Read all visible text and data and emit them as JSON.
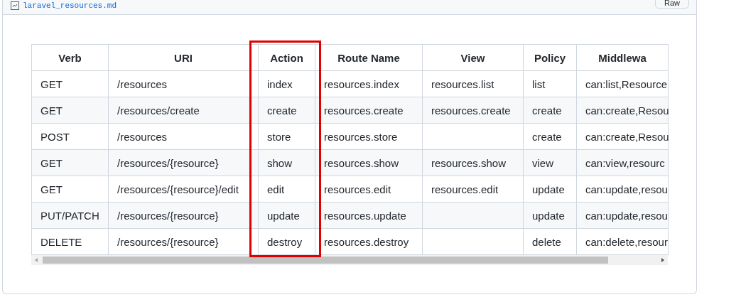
{
  "file_header": {
    "file_name": "laravel_resources.md",
    "raw_button": "Raw"
  },
  "table": {
    "columns": [
      {
        "label": "Verb",
        "highlighted": false
      },
      {
        "label": "URI",
        "highlighted": false
      },
      {
        "label": "Action",
        "highlighted": true
      },
      {
        "label": "Route Name",
        "highlighted": false
      },
      {
        "label": "View",
        "highlighted": false
      },
      {
        "label": "Policy",
        "highlighted": false
      },
      {
        "label": "Middlewa",
        "highlighted": false
      }
    ],
    "rows": [
      [
        "GET",
        "/resources",
        "index",
        "resources.index",
        "resources.list",
        "list",
        "can:list,Resource"
      ],
      [
        "GET",
        "/resources/create",
        "create",
        "resources.create",
        "resources.create",
        "create",
        "can:create,Resou"
      ],
      [
        "POST",
        "/resources",
        "store",
        "resources.store",
        "",
        "create",
        "can:create,Resou"
      ],
      [
        "GET",
        "/resources/{resource}",
        "show",
        "resources.show",
        "resources.show",
        "view",
        "can:view,resourc"
      ],
      [
        "GET",
        "/resources/{resource}/edit",
        "edit",
        "resources.edit",
        "resources.edit",
        "update",
        "can:update,resou"
      ],
      [
        "PUT/PATCH",
        "/resources/{resource}",
        "update",
        "resources.update",
        "",
        "update",
        "can:update,resou"
      ],
      [
        "DELETE",
        "/resources/{resource}",
        "destroy",
        "resources.destroy",
        "",
        "delete",
        "can:delete,resour"
      ]
    ]
  }
}
